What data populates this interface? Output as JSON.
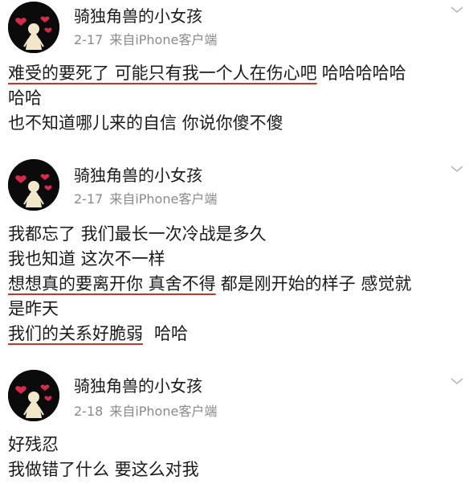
{
  "posts": [
    {
      "username": "骑独角兽的小女孩",
      "date": "2-17",
      "source": "来自iPhone客户端",
      "lines": [
        {
          "underlined": "难受的要死了 可能只有我一个人在伤心吧",
          "plain": "哈哈哈哈哈"
        },
        {
          "underlined": "",
          "plain": "哈哈"
        },
        {
          "underlined": "",
          "plain": "也不知道哪儿来的自信 你说你傻不傻"
        }
      ]
    },
    {
      "username": "骑独角兽的小女孩",
      "date": "2-17",
      "source": "来自iPhone客户端",
      "lines": [
        {
          "underlined": "",
          "plain": "我都忘了 我们最长一次冷战是多久"
        },
        {
          "underlined": "",
          "plain": "我也知道 这次不一样"
        },
        {
          "underlined": "想想真的要离开你 真舍不得",
          "plain": "都是刚开始的样子 感觉就"
        },
        {
          "underlined": "",
          "plain": "是昨天"
        },
        {
          "underlined": "我们的关系好脆弱",
          "plain": "哈哈"
        }
      ]
    },
    {
      "username": "骑独角兽的小女孩",
      "date": "2-18",
      "source": "来自iPhone客户端",
      "lines": [
        {
          "underlined": "",
          "plain": "好残忍"
        },
        {
          "underlined": "",
          "plain": "我做错了什么 要这么对我"
        }
      ]
    }
  ],
  "icons": {
    "avatar": "girl-with-hearts-avatar",
    "more": "chevron-down-icon"
  },
  "colors": {
    "text": "#1a1a1a",
    "meta": "#8a8a8a",
    "underline": "#c0392b",
    "avatar_bg": "#0b0b0b",
    "heart": "#d62b4b"
  }
}
